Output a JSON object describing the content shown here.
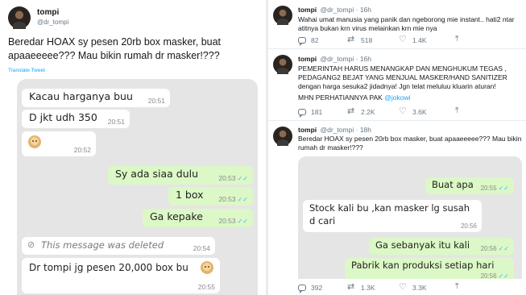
{
  "left_tweet": {
    "name": "tompi",
    "handle": "@dr_tompi",
    "text_line1": "Beredar HOAX sy pesen 20rb box masker, buat",
    "text_line2": "apaaeeeee??? Mau bikin rumah dr masker!???",
    "translate": "Translate Tweet",
    "chat": [
      {
        "text": "Kacau harganya buu",
        "time": "20:51",
        "side": "in"
      },
      {
        "text": "D jkt udh 350",
        "time": "20:51",
        "side": "in"
      },
      {
        "text": "",
        "time": "20:52",
        "side": "in",
        "emoji": "woman-emoji"
      },
      {
        "text": "Sy ada siaa dulu",
        "time": "20:53",
        "side": "out"
      },
      {
        "text": "1 box",
        "time": "20:53",
        "side": "out"
      },
      {
        "text": "Ga kepake",
        "time": "20:53",
        "side": "out"
      },
      {
        "text": "This message was deleted",
        "time": "20:54",
        "side": "in",
        "deleted": true
      },
      {
        "text": "Dr tompi jg pesen 20,000 box bu",
        "time": "20:55",
        "side": "in",
        "emoji": "woman-emoji"
      }
    ],
    "ticks": "✓✓"
  },
  "right_tweets": [
    {
      "name": "tompi",
      "handle": "@dr_tompi",
      "sep": "·",
      "age": "16h",
      "text": "Wahai umat manusia yang panik dan ngeborong mie instant.. hati2 ntar atitnya bukan krn virus melainkan krn mie nya",
      "replies": "82",
      "retweets": "518",
      "likes": "1.4K"
    },
    {
      "name": "tompi",
      "handle": "@dr_tompi",
      "sep": "·",
      "age": "16h",
      "text": "PEMERINTAH HARUS MENANGKAP DAN MENGHUKUM TEGAS , PEDAGANG2 BEJAT YANG MENJUAL MASKER/HAND SANITIZER dengan harga sesuka2 jidadnya!  Jgn telat meluluu kluarin aturan!",
      "text2": "MHN PERHATIANNYA PAK",
      "mention": "@jokowi",
      "replies": "181",
      "retweets": "2.2K",
      "likes": "3.6K"
    },
    {
      "name": "tompi",
      "handle": "@dr_tompi",
      "sep": "·",
      "age": "18h",
      "text": "Beredar HOAX sy pesen 20rb box masker, buat apaaeeeee??? Mau bikin rumah dr masker!???",
      "replies": "392",
      "retweets": "1.3K",
      "likes": "3.3K",
      "chat": [
        {
          "text": "Buat apa",
          "time": "20:55",
          "side": "out"
        },
        {
          "text": "Stock kali bu ,kan masker lg susah",
          "text2": "d cari",
          "time": "20:56",
          "side": "in"
        },
        {
          "text": "Ga sebanyak itu kali",
          "time": "20:56",
          "side": "out"
        },
        {
          "text": "Pabrik kan produksi setiap hari",
          "time": "20:56",
          "side": "out"
        }
      ]
    }
  ]
}
